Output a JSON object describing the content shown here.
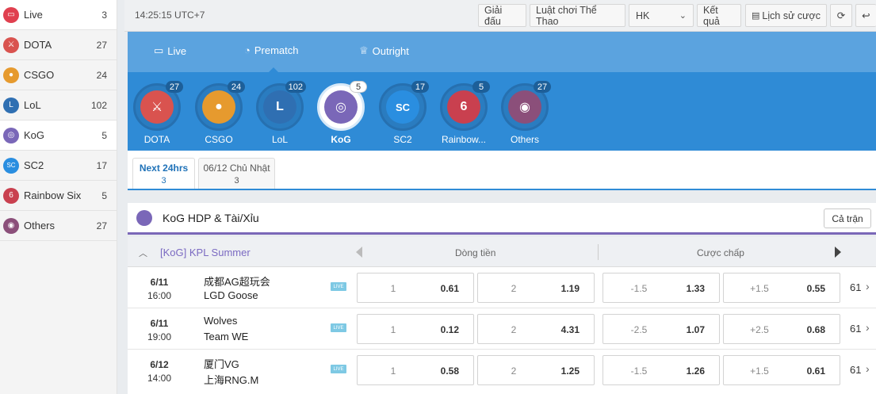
{
  "sidebar": {
    "items": [
      {
        "label": "Live",
        "count": "3",
        "icon": "tv-icon",
        "color": "#e0404f"
      },
      {
        "label": "DOTA",
        "count": "27",
        "icon": "dota-icon",
        "color": "#d9534f"
      },
      {
        "label": "CSGO",
        "count": "24",
        "icon": "csgo-icon",
        "color": "#e69a2e"
      },
      {
        "label": "LoL",
        "count": "102",
        "icon": "lol-icon",
        "color": "#2f6fb2"
      },
      {
        "label": "KoG",
        "count": "5",
        "icon": "kog-icon",
        "color": "#7a67b8"
      },
      {
        "label": "SC2",
        "count": "17",
        "icon": "sc2-icon",
        "color": "#2a8ee0"
      },
      {
        "label": "Rainbow Six",
        "count": "5",
        "icon": "rainbow-six-icon",
        "color": "#c9404f"
      },
      {
        "label": "Others",
        "count": "27",
        "icon": "gamepad-icon",
        "color": "#8b4f7a"
      }
    ]
  },
  "topbar": {
    "clock": "14:25:15 UTC+7",
    "tournaments": "Giải đấu",
    "rules": "Luật chơi Thể Thao",
    "odds_format": "HK",
    "results": "Kết quả",
    "bet_history": "Lịch sử cược"
  },
  "nav": {
    "live": "Live",
    "prematch": "Prematch",
    "outright": "Outright"
  },
  "sports": [
    {
      "name": "DOTA",
      "count": "27",
      "color": "#d9534f",
      "glyph": "D"
    },
    {
      "name": "CSGO",
      "count": "24",
      "color": "#e69a2e",
      "glyph": "C"
    },
    {
      "name": "LoL",
      "count": "102",
      "color": "#2f6fb2",
      "glyph": "L"
    },
    {
      "name": "KoG",
      "count": "5",
      "color": "#7a67b8",
      "glyph": "◎"
    },
    {
      "name": "SC2",
      "count": "17",
      "color": "#2a8ee0",
      "glyph": "SC"
    },
    {
      "name": "Rainbow...",
      "count": "5",
      "color": "#c9404f",
      "glyph": "6"
    },
    {
      "name": "Others",
      "count": "27",
      "color": "#8b4f7a",
      "glyph": "🎮"
    }
  ],
  "date_tabs": [
    {
      "label": "Next 24hrs",
      "count": "3"
    },
    {
      "label": "06/12 Chủ Nhật",
      "count": "3"
    }
  ],
  "market": {
    "title": "KoG  HDP & Tài/Xỉu",
    "all_button": "Cả trận"
  },
  "league": {
    "name": "[KoG] KPL Summer",
    "col_moneyline": "Dòng tiền",
    "col_handicap": "Cược chấp"
  },
  "matches": [
    {
      "date": "6/11",
      "time": "16:00",
      "team1": "成都AG超玩会",
      "team2": "LGD Goose",
      "live": "LIVE",
      "ml1_label": "1",
      "ml1": "0.61",
      "ml2_label": "2",
      "ml2": "1.19",
      "h1_label": "-1.5",
      "h1": "1.33",
      "h2_label": "+1.5",
      "h2": "0.55",
      "more": "61"
    },
    {
      "date": "6/11",
      "time": "19:00",
      "team1": "Wolves",
      "team2": "Team WE",
      "live": "LIVE",
      "ml1_label": "1",
      "ml1": "0.12",
      "ml2_label": "2",
      "ml2": "4.31",
      "h1_label": "-2.5",
      "h1": "1.07",
      "h2_label": "+2.5",
      "h2": "0.68",
      "more": "61"
    },
    {
      "date": "6/12",
      "time": "14:00",
      "team1": "厦门VG",
      "team2": "上海RNG.M",
      "live": "LIVE",
      "ml1_label": "1",
      "ml1": "0.58",
      "ml2_label": "2",
      "ml2": "1.25",
      "h1_label": "-1.5",
      "h1": "1.26",
      "h2_label": "+1.5",
      "h2": "0.61",
      "more": "61"
    }
  ]
}
